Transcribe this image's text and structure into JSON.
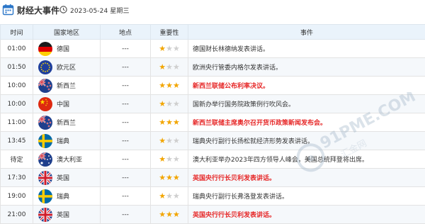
{
  "header": {
    "title": "财经大事件",
    "date": "2023-05-24 星期三"
  },
  "table": {
    "columns": [
      "时间",
      "国家地区",
      "地点",
      "重要性",
      "事件"
    ],
    "rows": [
      {
        "time": "01:00",
        "country": "德国",
        "flag": "germany",
        "place": "---",
        "stars": 1,
        "event": "德国财长林德纳发表讲话。",
        "highlight": false
      },
      {
        "time": "01:50",
        "country": "欧元区",
        "flag": "eu",
        "place": "---",
        "stars": 1,
        "event": "欧洲央行管委内格尔发表讲话。",
        "highlight": false
      },
      {
        "time": "10:00",
        "country": "新西兰",
        "flag": "newzealand",
        "place": "---",
        "stars": 3,
        "event": "新西兰联储公布利率决议。",
        "highlight": true
      },
      {
        "time": "10:00",
        "country": "中国",
        "flag": "china",
        "place": "---",
        "stars": 1,
        "event": "国新办举行国务院政策例行吹风会。",
        "highlight": false
      },
      {
        "time": "11:00",
        "country": "新西兰",
        "flag": "newzealand",
        "place": "---",
        "stars": 3,
        "event": "新西兰联储主席奥尔召开货币政策新闻发布会。",
        "highlight": true
      },
      {
        "time": "13:45",
        "country": "瑞典",
        "flag": "sweden",
        "place": "---",
        "stars": 1,
        "event": "瑞典央行副行长扬松就经济形势发表讲话。",
        "highlight": false
      },
      {
        "time": "待定",
        "country": "澳大利亚",
        "flag": "australia",
        "place": "---",
        "stars": 1,
        "event": "澳大利亚举办2023年四方领导人峰会，美国总统拜登将出席。",
        "highlight": false
      },
      {
        "time": "17:30",
        "country": "英国",
        "flag": "uk",
        "place": "---",
        "stars": 3,
        "event": "英国央行行长贝利发表讲话。",
        "highlight": true
      },
      {
        "time": "19:00",
        "country": "瑞典",
        "flag": "sweden",
        "place": "---",
        "stars": 1,
        "event": "瑞典央行副行长弗洛登发表讲话。",
        "highlight": false
      },
      {
        "time": "21:00",
        "country": "英国",
        "flag": "uk",
        "place": "---",
        "stars": 3,
        "event": "英国央行行长贝利发表讲话。",
        "highlight": true
      }
    ]
  },
  "watermark": {
    "text": "91PME.COM",
    "subtext": "汇金网"
  },
  "colors": {
    "header_bg": "#eaf3fb",
    "star_on": "#f2a500",
    "star_off": "#cfcfcf",
    "highlight": "#e62727",
    "icon_blue": "#2b76c8"
  },
  "icons": [
    "calendar-icon",
    "clock-icon"
  ]
}
